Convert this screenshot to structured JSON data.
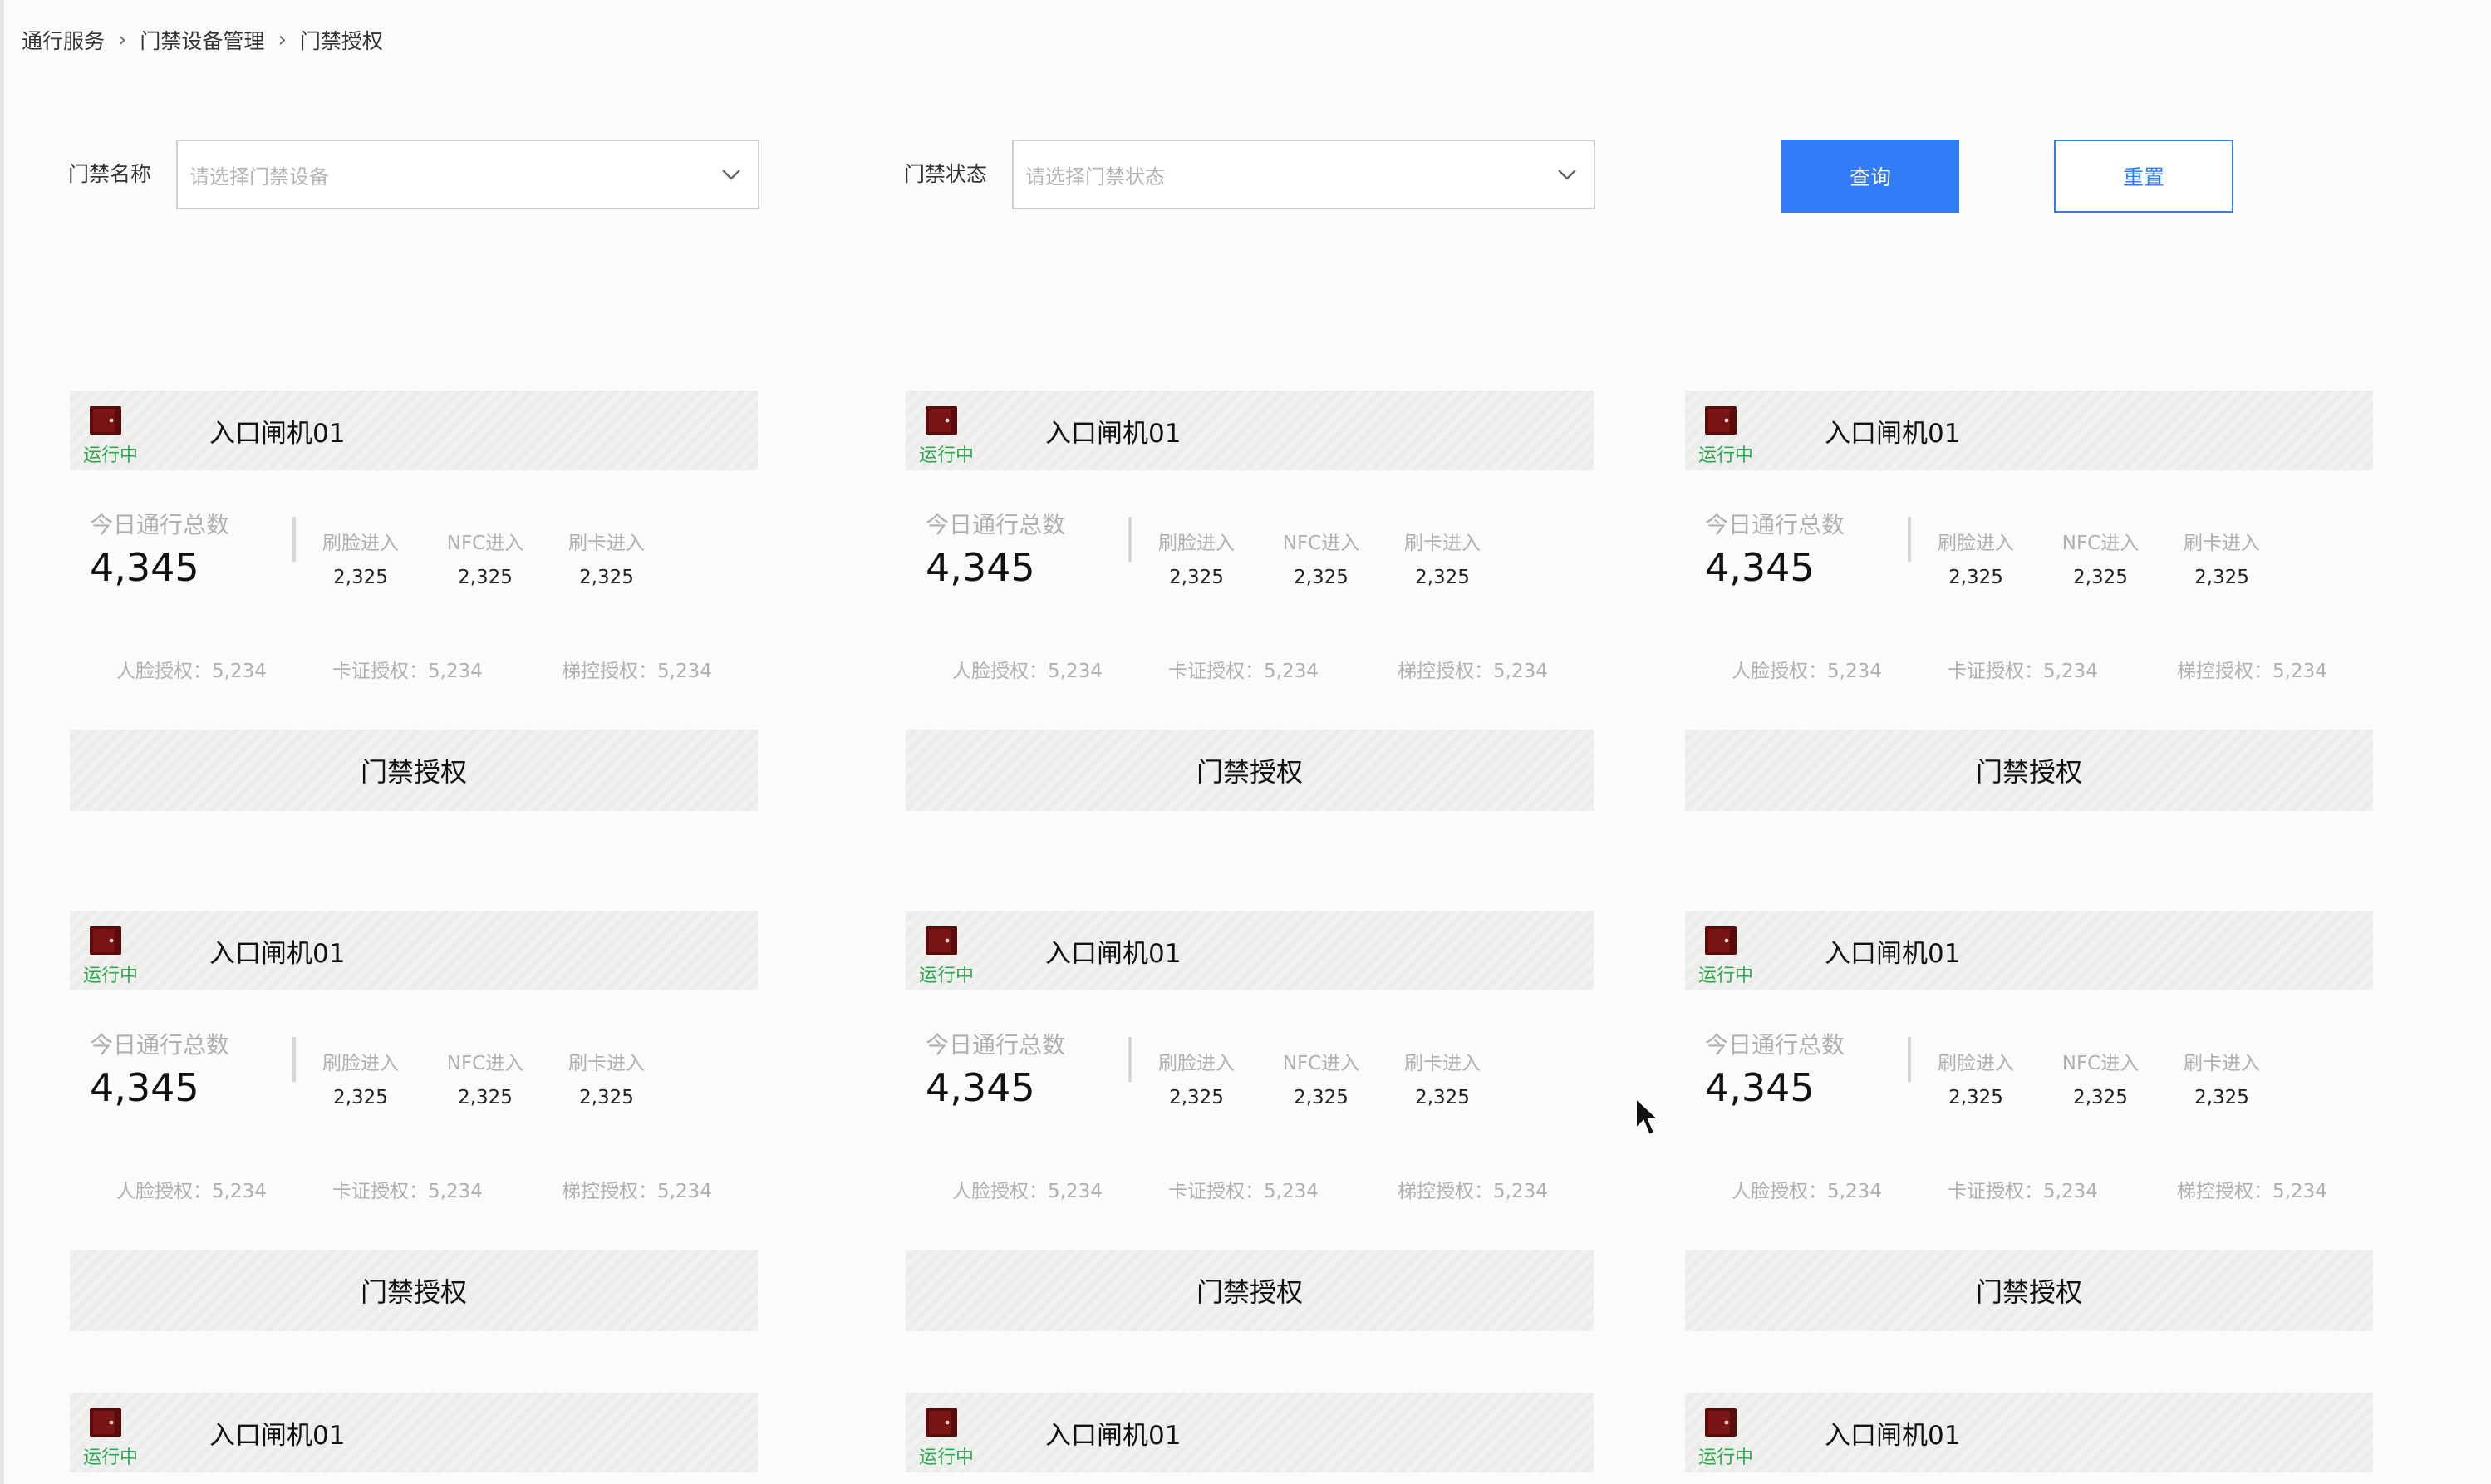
{
  "breadcrumb": [
    "通行服务",
    "门禁设备管理",
    "门禁授权"
  ],
  "filters": {
    "name_label": "门禁名称",
    "name_placeholder": "请选择门禁设备",
    "status_label": "门禁状态",
    "status_placeholder": "请选择门禁状态",
    "query_button": "查询",
    "reset_button": "重置"
  },
  "cards": [
    {
      "status": "运行中",
      "name": "入口闸机01",
      "total_label": "今日通行总数",
      "total": "4,345",
      "face_in_label": "刷脸进入",
      "face_in": "2,325",
      "nfc_in_label": "NFC进入",
      "nfc_in": "2,325",
      "card_in_label": "刷卡进入",
      "card_in": "2,325",
      "face_auth": "人脸授权：5,234",
      "card_auth": "卡证授权：5,234",
      "elevator_auth": "梯控授权：5,234",
      "action": "门禁授权"
    },
    {
      "status": "运行中",
      "name": "入口闸机01",
      "total_label": "今日通行总数",
      "total": "4,345",
      "face_in_label": "刷脸进入",
      "face_in": "2,325",
      "nfc_in_label": "NFC进入",
      "nfc_in": "2,325",
      "card_in_label": "刷卡进入",
      "card_in": "2,325",
      "face_auth": "人脸授权：5,234",
      "card_auth": "卡证授权：5,234",
      "elevator_auth": "梯控授权：5,234",
      "action": "门禁授权"
    },
    {
      "status": "运行中",
      "name": "入口闸机01",
      "total_label": "今日通行总数",
      "total": "4,345",
      "face_in_label": "刷脸进入",
      "face_in": "2,325",
      "nfc_in_label": "NFC进入",
      "nfc_in": "2,325",
      "card_in_label": "刷卡进入",
      "card_in": "2,325",
      "face_auth": "人脸授权：5,234",
      "card_auth": "卡证授权：5,234",
      "elevator_auth": "梯控授权：5,234",
      "action": "门禁授权"
    },
    {
      "status": "运行中",
      "name": "入口闸机01",
      "total_label": "今日通行总数",
      "total": "4,345",
      "face_in_label": "刷脸进入",
      "face_in": "2,325",
      "nfc_in_label": "NFC进入",
      "nfc_in": "2,325",
      "card_in_label": "刷卡进入",
      "card_in": "2,325",
      "face_auth": "人脸授权：5,234",
      "card_auth": "卡证授权：5,234",
      "elevator_auth": "梯控授权：5,234",
      "action": "门禁授权"
    },
    {
      "status": "运行中",
      "name": "入口闸机01",
      "total_label": "今日通行总数",
      "total": "4,345",
      "face_in_label": "刷脸进入",
      "face_in": "2,325",
      "nfc_in_label": "NFC进入",
      "nfc_in": "2,325",
      "card_in_label": "刷卡进入",
      "card_in": "2,325",
      "face_auth": "人脸授权：5,234",
      "card_auth": "卡证授权：5,234",
      "elevator_auth": "梯控授权：5,234",
      "action": "门禁授权"
    },
    {
      "status": "运行中",
      "name": "入口闸机01",
      "total_label": "今日通行总数",
      "total": "4,345",
      "face_in_label": "刷脸进入",
      "face_in": "2,325",
      "nfc_in_label": "NFC进入",
      "nfc_in": "2,325",
      "card_in_label": "刷卡进入",
      "card_in": "2,325",
      "face_auth": "人脸授权：5,234",
      "card_auth": "卡证授权：5,234",
      "elevator_auth": "梯控授权：5,234",
      "action": "门禁授权"
    },
    {
      "status": "运行中",
      "name": "入口闸机01"
    },
    {
      "status": "运行中",
      "name": "入口闸机01"
    },
    {
      "status": "运行中",
      "name": "入口闸机01"
    }
  ],
  "colors": {
    "accent": "#2f7cf6",
    "running": "#2fa84f",
    "door_icon": "#5a0b0b"
  }
}
